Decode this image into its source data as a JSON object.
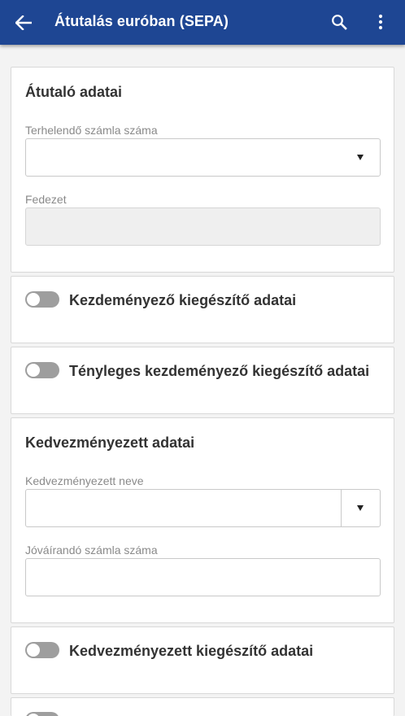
{
  "appbar": {
    "title": "Átutalás euróban (SEPA)",
    "back_icon": "arrow-left-icon",
    "search_icon": "search-icon",
    "more_icon": "more-vert-icon",
    "background": "#1e4693"
  },
  "sender_card": {
    "title": "Átutaló adatai",
    "debit_account_label": "Terhelendő számla száma",
    "debit_account_value": "",
    "coverage_label": "Fedezet",
    "coverage_value": ""
  },
  "initiator_toggle": {
    "label": "Kezdeményező kiegészítő adatai",
    "on": false
  },
  "actual_initiator_toggle": {
    "label": "Tényleges kezdeményező kiegészítő adatai",
    "on": false
  },
  "beneficiary_card": {
    "title": "Kedvezményezett adatai",
    "name_label": "Kedvezményezett neve",
    "name_value": "",
    "credit_account_label": "Jóváírandó számla száma",
    "credit_account_value": ""
  },
  "beneficiary_extra_toggle": {
    "label": "Kedvezményezett kiegészítő adatai",
    "on": false
  },
  "colors": {
    "toggle_off": "#9e9e9e",
    "card_border": "#d8d8d8",
    "page_bg": "#f3f3f3"
  }
}
